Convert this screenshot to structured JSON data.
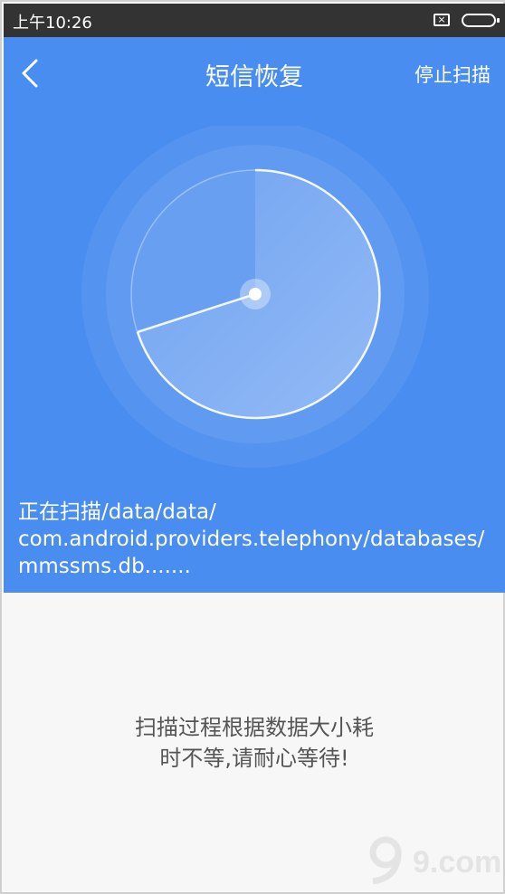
{
  "status_bar": {
    "time": "上午10:26",
    "sim_icon": "sim-x-icon",
    "battery_icon": "battery-icon"
  },
  "header": {
    "back_icon": "chevron-left-icon",
    "title": "短信恢复",
    "stop_label": "停止扫描"
  },
  "scan": {
    "line1": "正在扫描/data/data/",
    "line2": "com.android.providers.telephony/databases/",
    "line3": "mmssms.db......."
  },
  "hint": {
    "line1": "扫描过程根据数据大小耗",
    "line2": "时不等,请耐心等待!"
  },
  "watermark": {
    "logo": "9com",
    "text": "9.com"
  },
  "colors": {
    "primary_blue": "#4a8df0",
    "status_bar": "#333333",
    "background": "#f7f7f7"
  }
}
